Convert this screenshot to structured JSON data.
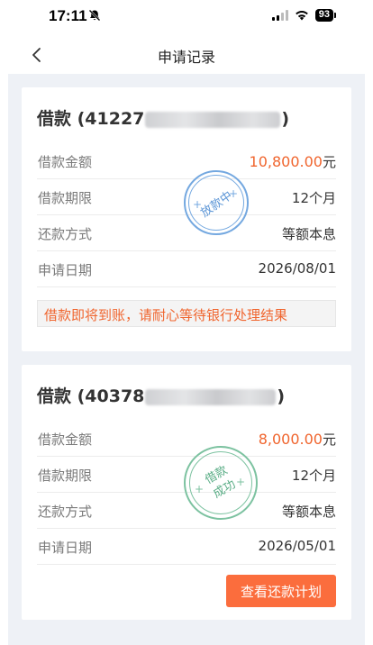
{
  "status_bar": {
    "time": "17:11",
    "battery": "93"
  },
  "nav": {
    "title": "申请记录"
  },
  "loans": [
    {
      "title_prefix": "借款 (41227",
      "title_suffix": ")",
      "rows": [
        {
          "label": "借款金额",
          "value": "10,800.00",
          "unit": "元"
        },
        {
          "label": "借款期限",
          "value": "12个月"
        },
        {
          "label": "还款方式",
          "value": "等额本息"
        },
        {
          "label": "申请日期",
          "value": "2026/08/01"
        }
      ],
      "stamp": "放款中",
      "notice": "借款即将到账，请耐心等待银行处理结果"
    },
    {
      "title_prefix": "借款 (40378",
      "title_suffix": ")",
      "rows": [
        {
          "label": "借款金额",
          "value": "8,000.00",
          "unit": "元"
        },
        {
          "label": "借款期限",
          "value": "12个月"
        },
        {
          "label": "还款方式",
          "value": "等额本息"
        },
        {
          "label": "申请日期",
          "value": "2026/05/01"
        }
      ],
      "stamp_line1": "借款",
      "stamp_line2": "成功",
      "button_label": "查看还款计划"
    }
  ],
  "colors": {
    "accent": "#f0652e",
    "button": "#fb6d3d",
    "stamp_blue": "#74a8e0",
    "stamp_green": "#7cc2a0",
    "background": "#eef1f6"
  },
  "icons": [
    "bell-off-icon",
    "signal-icon",
    "wifi-icon",
    "battery-icon",
    "back-chevron-icon"
  ]
}
